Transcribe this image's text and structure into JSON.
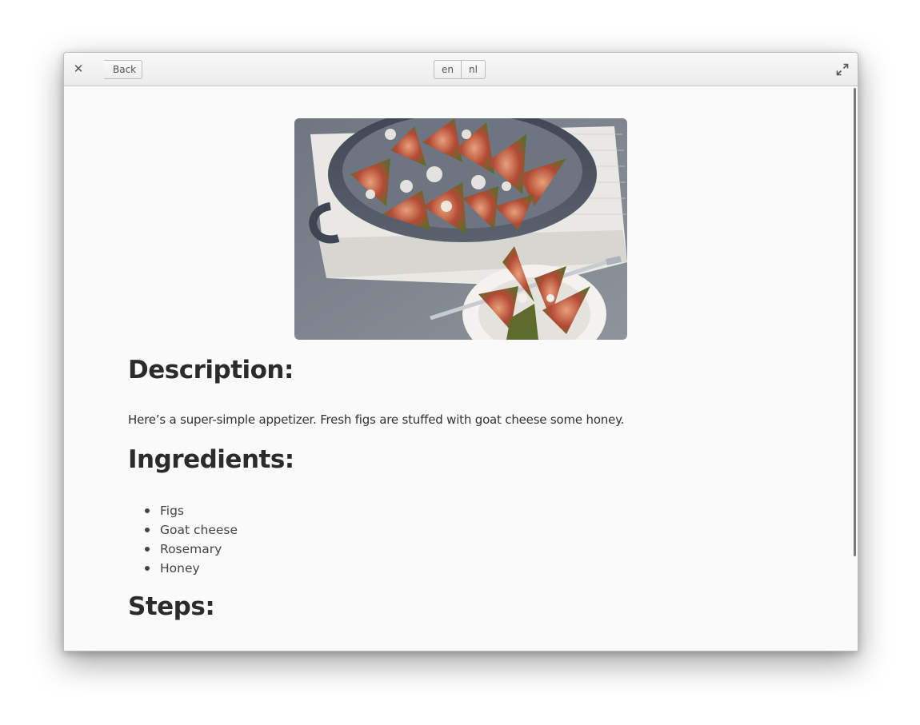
{
  "header": {
    "close_icon": "close-icon",
    "back_label": "Back",
    "languages": [
      "en",
      "nl"
    ],
    "expand_icon": "fullscreen-expand-icon"
  },
  "recipe": {
    "image": "fig-goat-cheese-photo",
    "description_heading": "Description:",
    "description_text": "Here’s a super-simple appetizer. Fresh figs are stuffed with goat cheese some honey.",
    "ingredients_heading": "Ingredients:",
    "ingredients": [
      "Figs",
      "Goat cheese",
      "Rosemary",
      "Honey"
    ],
    "steps_heading": "Steps:"
  }
}
